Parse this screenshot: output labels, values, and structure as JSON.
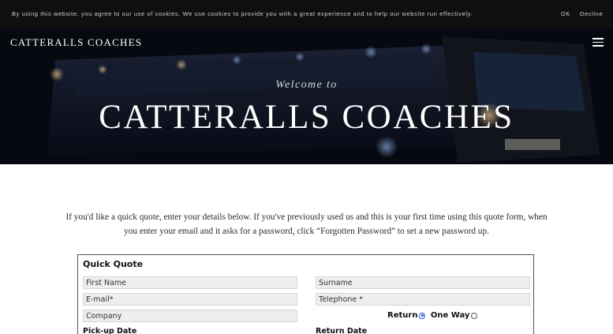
{
  "cookie_bar": {
    "message": "By using this website, you agree to our use of cookies. We use cookies to provide you with a great experience and to help our website run effectively.",
    "ok_label": "OK",
    "decline_label": "Decline"
  },
  "header": {
    "logo": "CATTERALLS COACHES",
    "menu_icon": "hamburger-menu-icon"
  },
  "hero": {
    "welcome": "Welcome to",
    "title": "CATTERALLS COACHES"
  },
  "intro": {
    "line1": "If you'd like a quick quote, enter your details below.  If you've previously used us and this is your first time using this quote form, when",
    "line2": "you enter your email and it asks for a password, click “Forgotten Password” to set a new password up."
  },
  "quote_form": {
    "title": "Quick Quote",
    "first_name_placeholder": "First Name",
    "surname_placeholder": "Surname",
    "email_placeholder": "E-mail*",
    "telephone_placeholder": "Telephone *",
    "company_placeholder": "Company",
    "return_label": "Return",
    "one_way_label": "One Way",
    "selected_trip": "Return",
    "pickup_date_label": "Pick-up Date",
    "return_date_label": "Return Date"
  },
  "colors": {
    "cookie_bg": "#0f0f0f",
    "radio_accent": "#1a5bd8",
    "form_border": "#555555"
  }
}
